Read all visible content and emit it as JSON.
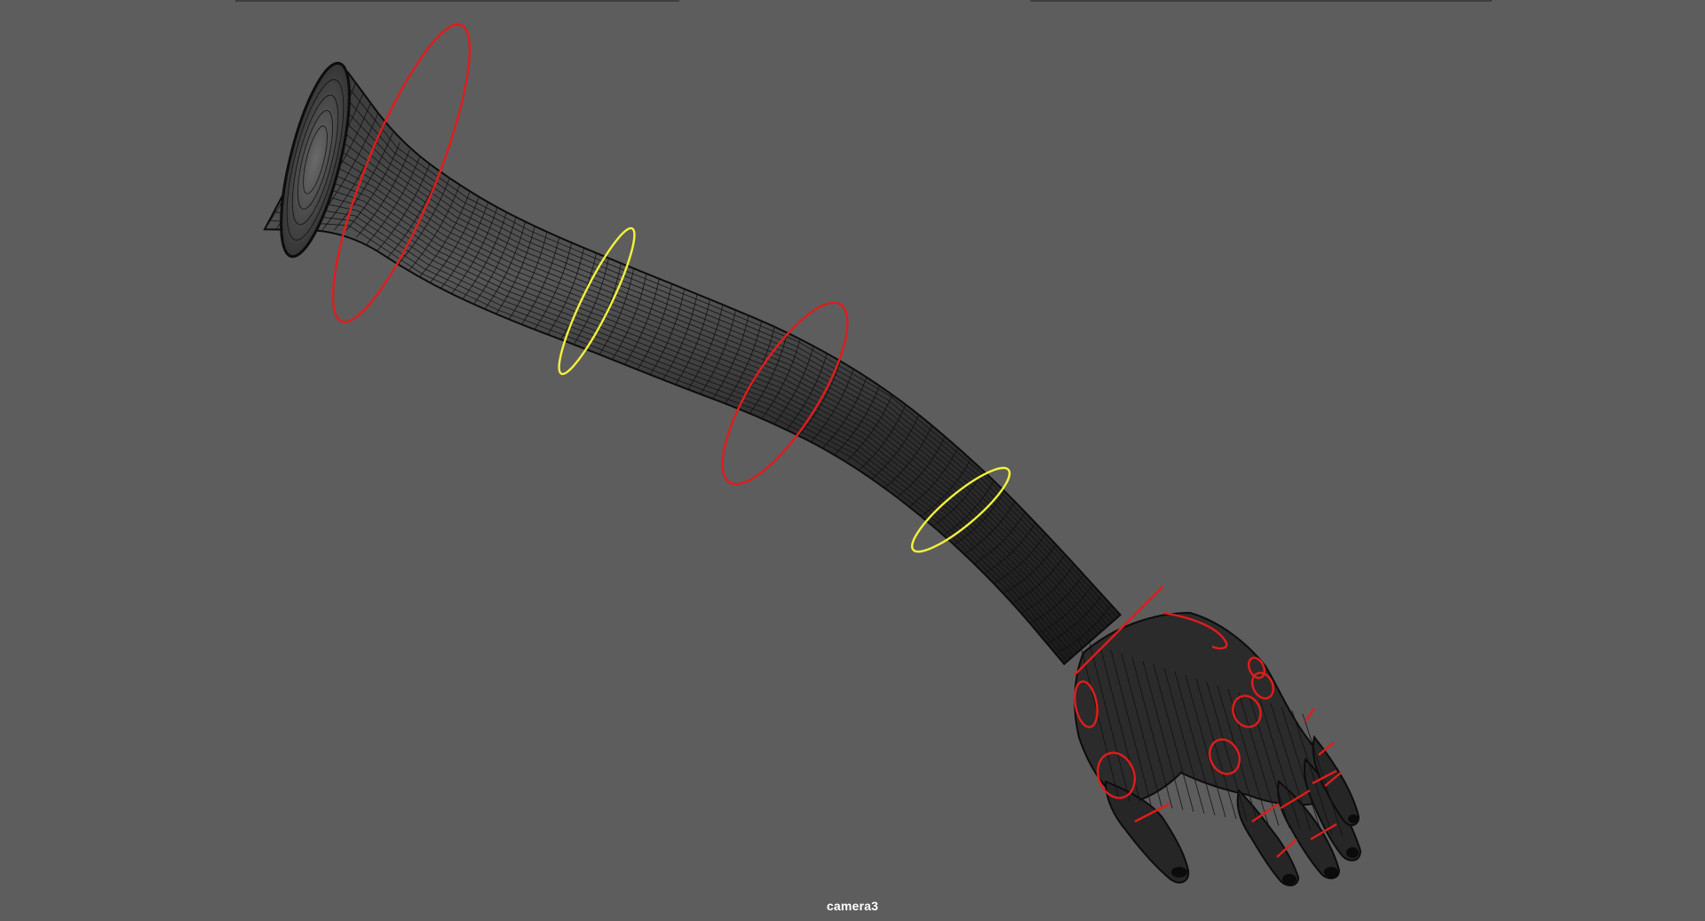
{
  "viewport": {
    "camera_label": "camera3",
    "background_color": "#5d5d5d"
  },
  "mesh": {
    "object": "arm",
    "display": "wireframe-on-shaded",
    "base_color": "#2a2a2a",
    "wire_color": "#101010"
  },
  "controls": {
    "fk_color": "#e21c1c",
    "ik_color": "#f2f23c",
    "items": [
      {
        "name": "shoulder-ctrl",
        "color": "red"
      },
      {
        "name": "upperarm-twist-ctrl",
        "color": "yellow"
      },
      {
        "name": "elbow-ctrl",
        "color": "red"
      },
      {
        "name": "forearm-twist-ctrl",
        "color": "yellow"
      },
      {
        "name": "wrist-ctrl",
        "color": "red"
      },
      {
        "name": "thumb-ctrls",
        "color": "red"
      },
      {
        "name": "finger-ctrls",
        "color": "red"
      }
    ]
  }
}
